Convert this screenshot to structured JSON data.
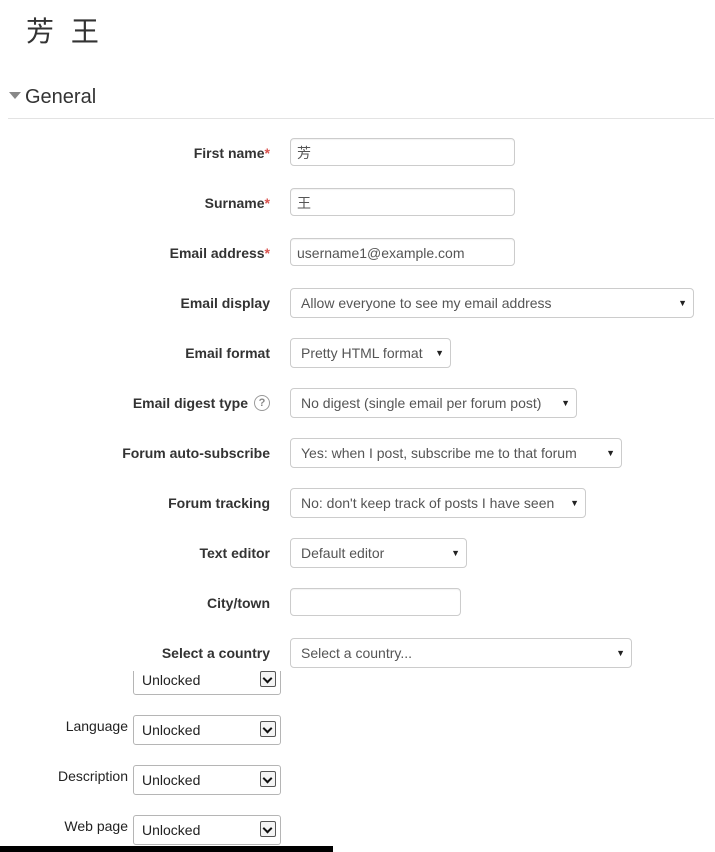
{
  "page": {
    "title": "芳 王"
  },
  "section": {
    "title": "General"
  },
  "form": {
    "first_name": {
      "label": "First name",
      "value": "芳"
    },
    "surname": {
      "label": "Surname",
      "value": "王"
    },
    "email": {
      "label": "Email address",
      "value": "username1@example.com"
    },
    "email_display": {
      "label": "Email display",
      "value": "Allow everyone to see my email address"
    },
    "email_format": {
      "label": "Email format",
      "value": "Pretty HTML format"
    },
    "email_digest": {
      "label": "Email digest type",
      "help_icon": "?",
      "value": "No digest (single email per forum post)"
    },
    "forum_autosubscribe": {
      "label": "Forum auto-subscribe",
      "value": "Yes: when I post, subscribe me to that forum"
    },
    "forum_tracking": {
      "label": "Forum tracking",
      "value": "No: don't keep track of posts I have seen"
    },
    "text_editor": {
      "label": "Text editor",
      "value": "Default editor"
    },
    "city": {
      "label": "City/town",
      "value": ""
    },
    "country": {
      "label": "Select a country",
      "value": "Select a country..."
    }
  },
  "required_marker": "*",
  "caret_glyph": "▼",
  "lock_fields": {
    "partial": {
      "value": "Unlocked"
    },
    "language": {
      "label": "Language",
      "value": "Unlocked"
    },
    "description": {
      "label": "Description",
      "value": "Unlocked"
    },
    "webpage": {
      "label": "Web page",
      "value": "Unlocked"
    }
  },
  "colors": {
    "required": "#d9534f",
    "border": "#cccccc",
    "text": "#333333"
  }
}
